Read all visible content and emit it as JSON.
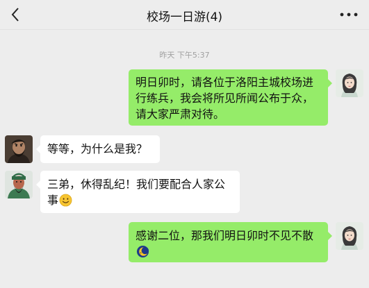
{
  "header": {
    "title": "校场一日游(4)",
    "back_icon": "chevron-left-icon",
    "more_icon": "more-dots-icon"
  },
  "timestamp": "昨天 下午5:37",
  "messages": [
    {
      "sender": "me",
      "avatar": "woman-avatar",
      "text": "明日卯时，请各位于洛阳主城校场进行练兵，我会将所见所闻公布于众，请大家严肃对待。"
    },
    {
      "sender": "other",
      "avatar": "bearded-warrior-avatar",
      "text": "等等，为什么是我？"
    },
    {
      "sender": "other",
      "avatar": "green-warrior-avatar",
      "text": "三弟，休得乱纪！我们要配合人家公事",
      "emoji": "smile-emoji"
    },
    {
      "sender": "me",
      "avatar": "woman-avatar",
      "text": "感谢二位，那我们明日卯时不见不散",
      "emoji": "moon-emoji"
    }
  ],
  "colors": {
    "background": "#ededed",
    "my_bubble": "#95ec69",
    "other_bubble": "#ffffff",
    "timestamp": "#a0a0a0"
  }
}
